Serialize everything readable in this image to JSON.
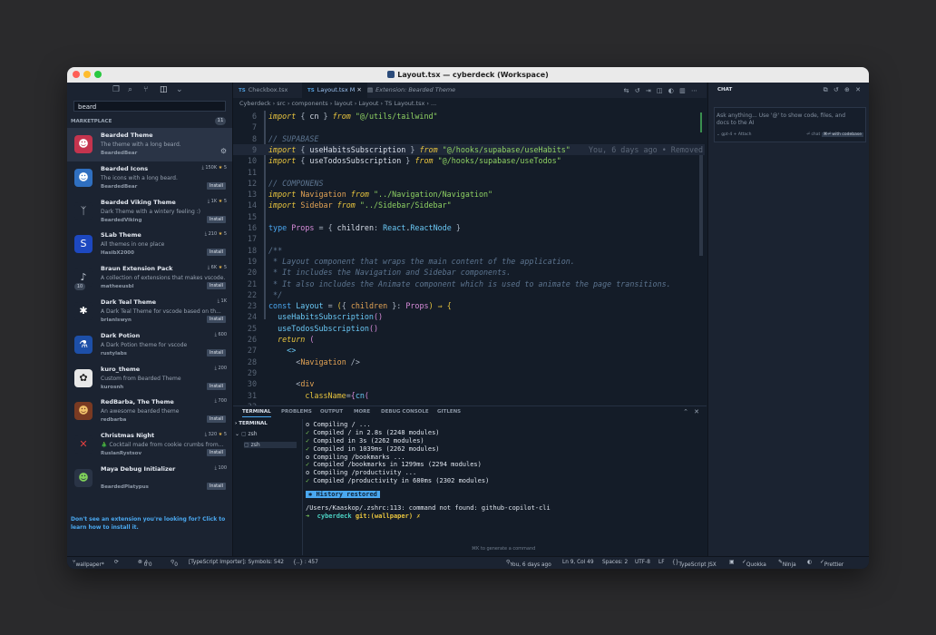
{
  "window": {
    "title": "Layout.tsx — cyberdeck (Workspace)"
  },
  "sidebar": {
    "search_value": "beard",
    "section_label": "MARKETPLACE",
    "section_count": "11",
    "footer": "Don't see an extension you're looking for? Click to learn how to install it.",
    "extensions": [
      {
        "name": "Bearded Theme",
        "desc": "The theme with a long beard.",
        "author": "BeardedBear",
        "downloads": "",
        "rating": "",
        "install": "",
        "selected": true
      },
      {
        "name": "Bearded Icons",
        "desc": "The icons with a long beard.",
        "author": "BeardedBear",
        "downloads": "150K",
        "rating": "5",
        "install": "Install"
      },
      {
        "name": "Bearded Viking Theme",
        "desc": "Dark Theme with a wintery feeling :)",
        "author": "BeardedViking",
        "downloads": "1K",
        "rating": "5",
        "install": "Install"
      },
      {
        "name": "SLab Theme",
        "desc": "All themes in one place",
        "author": "HasibX2000",
        "downloads": "210",
        "rating": "5",
        "install": "Install"
      },
      {
        "name": "Braun Extension Pack",
        "desc": "A collection of extensions that makes vscode...",
        "author": "matheeusbl",
        "downloads": "6K",
        "rating": "5",
        "install": "Install",
        "badge": "10"
      },
      {
        "name": "Dark Teal Theme",
        "desc": "A Dark Teal Theme for vscode based on th...",
        "author": "brianlswyn",
        "downloads": "1K",
        "rating": "",
        "install": "Install"
      },
      {
        "name": "Dark Potion",
        "desc": "A Dark Potion theme for vscode",
        "author": "rustylabs",
        "downloads": "600",
        "rating": "",
        "install": "Install"
      },
      {
        "name": "kuro_theme",
        "desc": "Custom from Bearded Theme",
        "author": "kurosnh",
        "downloads": "200",
        "rating": "",
        "install": "Install"
      },
      {
        "name": "RedBarba, The Theme",
        "desc": "An awesome bearded theme",
        "author": "redbarba",
        "downloads": "700",
        "rating": "",
        "install": "Install"
      },
      {
        "name": "Christmas Night",
        "desc": "🎄 Cocktail made from cookie crumbs from...",
        "author": "RuslanRystsov",
        "downloads": "320",
        "rating": "5",
        "install": "Install"
      },
      {
        "name": "Maya Debug Initializer",
        "desc": "",
        "author": "BeardedPlatypus",
        "downloads": "100",
        "rating": "",
        "install": "Install"
      }
    ]
  },
  "editor": {
    "tabs": [
      {
        "label": "Checkbox.tsx",
        "prefix": "TS"
      },
      {
        "label": "Layout.tsx M",
        "prefix": "TS"
      },
      {
        "label": "Extension: Bearded Theme",
        "prefix": ""
      }
    ],
    "breadcrumbs": "Cyberdeck  ›  src  ›  components  ›  layout  ›  Layout  ›  TS Layout.tsx  ›  ...",
    "blame": "You, 6 days ago • Removed",
    "lines": [
      "6",
      "7",
      "8",
      "9",
      "10",
      "11",
      "12",
      "13",
      "14",
      "15",
      "16",
      "17",
      "18",
      "19",
      "20",
      "21",
      "22",
      "23",
      "24",
      "25",
      "26",
      "27",
      "28",
      "29",
      "30",
      "31",
      "32"
    ]
  },
  "panel": {
    "tabs": [
      "TERMINAL",
      "PROBLEMS",
      "OUTPUT",
      "MORE",
      "DEBUG CONSOLE",
      "GITLENS"
    ],
    "terminal_title": "TERMINAL",
    "shells": [
      "zsh",
      "zsh"
    ],
    "output": [
      "o Compiling / ...",
      "✓ Compiled / in 2.8s (2248 modules)",
      "✓ Compiled in 3s (2262 modules)",
      "✓ Compiled in 1039ms (2262 modules)",
      "o Compiling /bookmarks ...",
      "✓ Compiled /bookmarks in 1299ms (2294 modules)",
      "o Compiling /productivity ...",
      "✓ Compiled /productivity in 680ms (2302 modules)"
    ],
    "history": "History restored",
    "error": "/Users/Kaaskop/.zshrc:113: command not found: github-copilot-cli",
    "prompt_dir": "cyberdeck",
    "prompt_branch": "git:(wallpaper) ✗",
    "hint": "⌘K to generate a command"
  },
  "chat": {
    "title": "CHAT",
    "placeholder": "Ask anything... Use '@' to show code, files, and docs to the AI",
    "model": "gpt-4",
    "attach": "Attach",
    "chat_label": "chat",
    "codebase": "⌘⏎ with codebase"
  },
  "status": {
    "branch": "wallpaper*",
    "sync": "⟳",
    "errors": "0",
    "warnings": "0",
    "ports": "0",
    "importer": "[TypeScript Importer]: Symbols: 542",
    "braces": "{..} : 457",
    "blame": "You, 6 days ago",
    "position": "Ln 9, Col 49",
    "spaces": "Spaces: 2",
    "encoding": "UTF-8",
    "eol": "LF",
    "language": "TypeScript JSX",
    "quokka": "Quokka",
    "ninja": "Ninja",
    "prettier": "Prettier"
  },
  "colors": {
    "accent": "#4aa8f0",
    "keyword": "#e9c53e",
    "string": "#8fd263",
    "background": "#141c28"
  }
}
